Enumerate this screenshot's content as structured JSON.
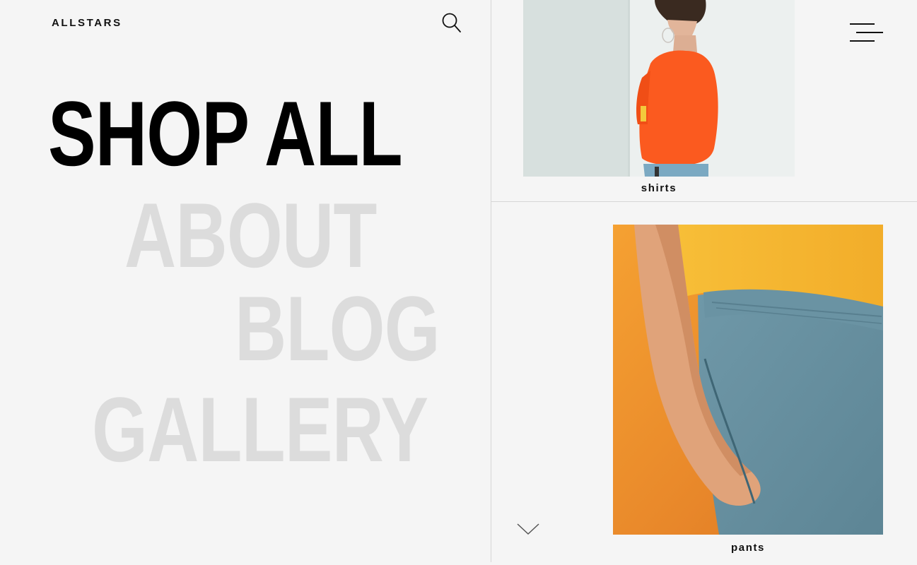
{
  "header": {
    "logo": "ALLSTARS",
    "search_icon": "search-icon",
    "menu_icon": "hamburger-menu-icon"
  },
  "nav": {
    "items": [
      {
        "label": "SHOP ALL",
        "active": true
      },
      {
        "label": "ABOUT",
        "active": false
      },
      {
        "label": "BLOG",
        "active": false
      },
      {
        "label": "GALLERY",
        "active": false
      }
    ]
  },
  "categories": [
    {
      "label": "shirts"
    },
    {
      "label": "pants"
    }
  ],
  "scroll": {
    "icon": "chevron-down-icon"
  },
  "colors": {
    "background": "#f5f5f5",
    "text": "#000000",
    "faded_text": "#dcdcdc",
    "divider": "#d6d6d6"
  }
}
